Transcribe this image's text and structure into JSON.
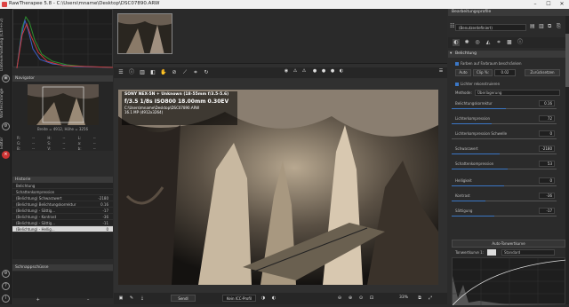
{
  "titlebar": {
    "title": "RawTherapee 5.8 - C:\\Users\\mname\\Desktop\\DSC07890.ARW",
    "minimize": "–",
    "maximize": "☐",
    "close": "✕"
  },
  "vtabs": {
    "file_browser": "Dateiverwaltung (Ctrl+F2)",
    "queue": "Warteschlange",
    "editor": "Editor"
  },
  "left": {
    "navigator_title": "Navigator",
    "navigator_info": "Breite = 4912, Höhe = 3256",
    "navigator_values": [
      "R:",
      "--",
      "H:",
      "--",
      "L:",
      "--",
      "G:",
      "--",
      "S:",
      "--",
      "a:",
      "--",
      "B:",
      "--",
      "V:",
      "--",
      "b:",
      "--"
    ],
    "history_title": "Historie",
    "history_rows": [
      {
        "label": "Belichtung",
        "value": ""
      },
      {
        "label": "Schattenkompression",
        "value": ""
      },
      {
        "label": "(Belichtung) Schwarzwert",
        "value": "-2180"
      },
      {
        "label": "(Belichtung) Belichtungskorrektur",
        "value": "0.16"
      },
      {
        "label": "(Belichtung) - Sättig...",
        "value": "-17"
      },
      {
        "label": "(Belichtung) - Kontrast",
        "value": "-36"
      },
      {
        "label": "(Belichtung) - Sättig...",
        "value": "-11"
      },
      {
        "label": "(Belichtung) - Hellig...",
        "value": "0"
      }
    ],
    "snapshot_title": "Schnappschüsse",
    "snapshot_add": "+",
    "snapshot_remove": "–"
  },
  "center": {
    "exif": {
      "camera": "SONY NEX-5N + Unknown (18-55mm f/3.5-5.6)",
      "settings": "f/3.5  1/8s  ISO800  18.00mm  0.30EV",
      "path": "C:\\Users\\mname\\Desktop\\DSC07890.ARW",
      "size": "16.1 MP (4912x3264)"
    },
    "statusbar": {
      "zoom": "33%",
      "profile_dropdown": "Kein ICC-Profil",
      "batch": "Sendl"
    }
  },
  "right": {
    "header": "Bearbeitungsprofile",
    "profile_selected": "(Benutzerdefiniert)",
    "section_title": "Belichtung",
    "clip_label": "Farben auf Farbraum beschränken",
    "auto_btn": "Auto",
    "clip_btn": "Clip %:",
    "clip_val": "0.02",
    "reset_btn": "Zurücksetzen",
    "highlight_label": "Lichter rekonstruieren",
    "method_label": "Methode:",
    "method_value": "Überlagerung",
    "sliders": [
      {
        "label": "Belichtungskorrektur",
        "value": "0.16",
        "fill": 0.52
      },
      {
        "label": "Lichterkompression",
        "value": "72",
        "fill": 0.38
      },
      {
        "label": "Lichterkompression Schwelle",
        "value": "0",
        "fill": 0.0
      },
      {
        "label": "Schwarzwert",
        "value": "-2180",
        "fill": 0.46
      },
      {
        "label": "Schattenkompression",
        "value": "53",
        "fill": 0.53
      },
      {
        "label": "Helligkeit",
        "value": "0",
        "fill": 0.5
      },
      {
        "label": "Kontrast",
        "value": "-36",
        "fill": 0.32
      },
      {
        "label": "Sättigung",
        "value": "-17",
        "fill": 0.41
      }
    ],
    "tone_curve_header": "Auto-Tonwertkurve",
    "tone_curve_label": "Tonwertkurve 1:",
    "tone_curve_mode": "Standard"
  },
  "colors": {
    "accent": "#3b77c6",
    "bg": "#2b2b2b",
    "panel": "#3a3a3a"
  }
}
